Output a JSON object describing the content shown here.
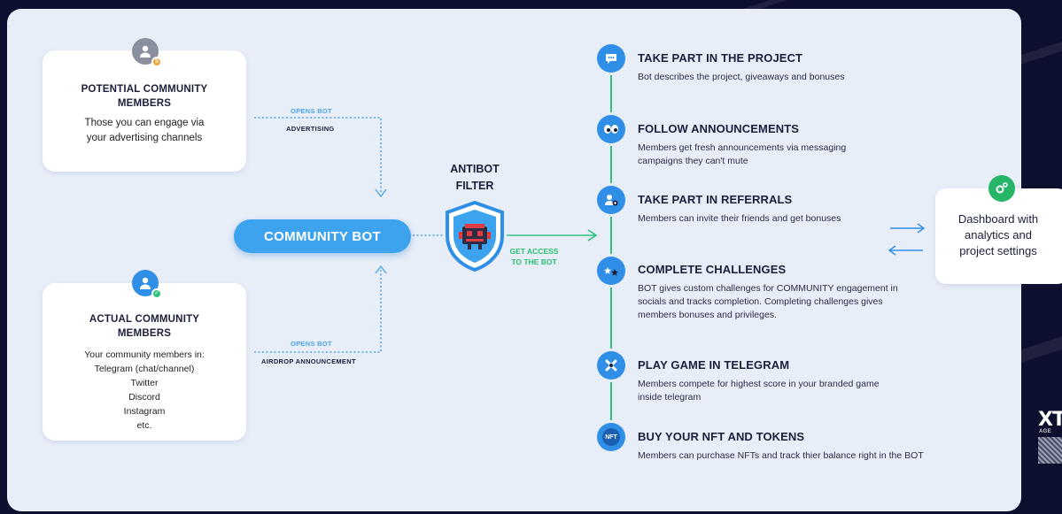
{
  "potential": {
    "title": "POTENTIAL COMMUNITY MEMBERS",
    "desc": "Those you can engage via your advertising channels",
    "opens_bot": "OPENS BOT",
    "channel": "ADVERTISING"
  },
  "actual": {
    "title": "ACTUAL COMMUNITY MEMBERS",
    "lines": [
      "Your community members in:",
      "Telegram (chat/channel)",
      "Twitter",
      "Discord",
      "Instagram",
      "etc."
    ],
    "opens_bot": "OPENS BOT",
    "channel": "AIRDROP ANNOUNCEMENT"
  },
  "bot_label": "COMMUNITY BOT",
  "antibot": {
    "title_line1": "ANTIBOT",
    "title_line2": "FILTER"
  },
  "get_access": {
    "line1": "GET ACCESS",
    "line2": "TO THE BOT"
  },
  "steps": [
    {
      "icon": "chat-bubble-icon",
      "title": "TAKE PART IN THE PROJECT",
      "desc": "Bot describes the project, giveaways and bonuses"
    },
    {
      "icon": "eyes-icon",
      "title": "FOLLOW ANNOUNCEMENTS",
      "desc": "Members get fresh announcements via messaging campaigns they can't mute"
    },
    {
      "icon": "add-user-icon",
      "title": "TAKE PART IN REFERRALS",
      "desc": "Members can invite their friends and get bonuses"
    },
    {
      "icon": "stars-icon",
      "title": "COMPLETE CHALLENGES",
      "desc": "BOT gives custom challenges for COMMUNITY engagement in socials and tracks completion. Completing challenges gives members bonuses and privileges."
    },
    {
      "icon": "gamepad-icon",
      "title": "PLAY GAME IN TELEGRAM",
      "desc": "Members compete for highest score in your branded  game inside telegram"
    },
    {
      "icon": "nft-icon",
      "icon_text": "NFT",
      "title": "BUY YOUR NFT AND TOKENS",
      "desc": "Members can purchase NFTs and track thier balance right in the BOT"
    }
  ],
  "dashboard": {
    "line1": "Dashboard with",
    "line2": "analytics and",
    "line3": "project settings"
  },
  "logo": {
    "text": "XT",
    "subtext": "AGE"
  },
  "colors": {
    "accent_blue": "#3ea3ef",
    "green": "#2ec27e",
    "dark_bg": "#0d0f2e",
    "panel": "#e8eef8"
  }
}
